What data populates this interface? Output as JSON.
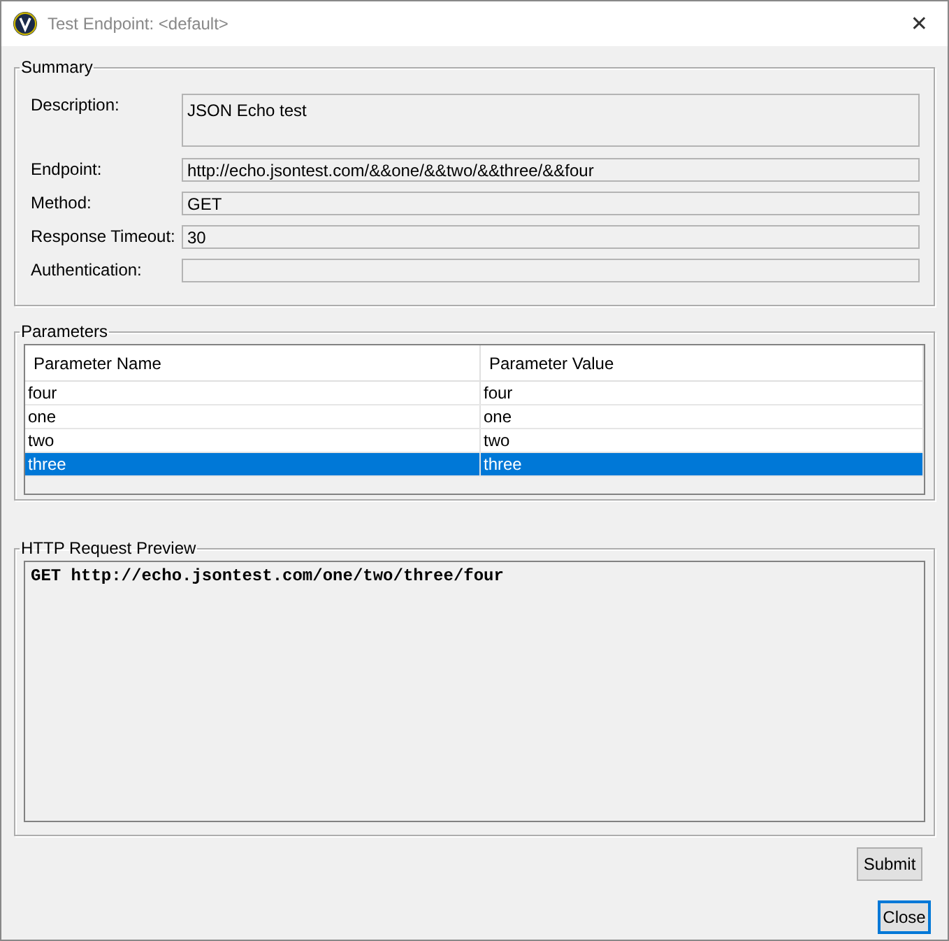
{
  "window": {
    "title": "Test Endpoint: <default>",
    "close_glyph": "✕"
  },
  "summary": {
    "title": "Summary",
    "fields": [
      {
        "label": "Description:",
        "value": "JSON Echo test",
        "kind": "multiline"
      },
      {
        "label": "Endpoint:",
        "value": "http://echo.jsontest.com/&&one/&&two/&&three/&&four",
        "kind": "single"
      },
      {
        "label": "Method:",
        "value": "GET",
        "kind": "single"
      },
      {
        "label": "Response Timeout:",
        "value": "30",
        "kind": "single"
      },
      {
        "label": "Authentication:",
        "kind": "single"
      }
    ]
  },
  "parameters": {
    "title": "Parameters",
    "columns": [
      "Parameter Name",
      "Parameter Value"
    ],
    "rows": [
      {
        "cells": [
          "four",
          "four"
        ],
        "selected": false
      },
      {
        "cells": [
          "one",
          "one"
        ],
        "selected": false
      },
      {
        "cells": [
          "two",
          "two"
        ],
        "selected": false
      },
      {
        "cells": [
          "three",
          "three"
        ],
        "selected": true
      }
    ]
  },
  "preview": {
    "title": "HTTP Request Preview",
    "text": "GET http://echo.jsontest.com/one/two/three/four"
  },
  "buttons": {
    "submit": "Submit",
    "close": "Close"
  }
}
